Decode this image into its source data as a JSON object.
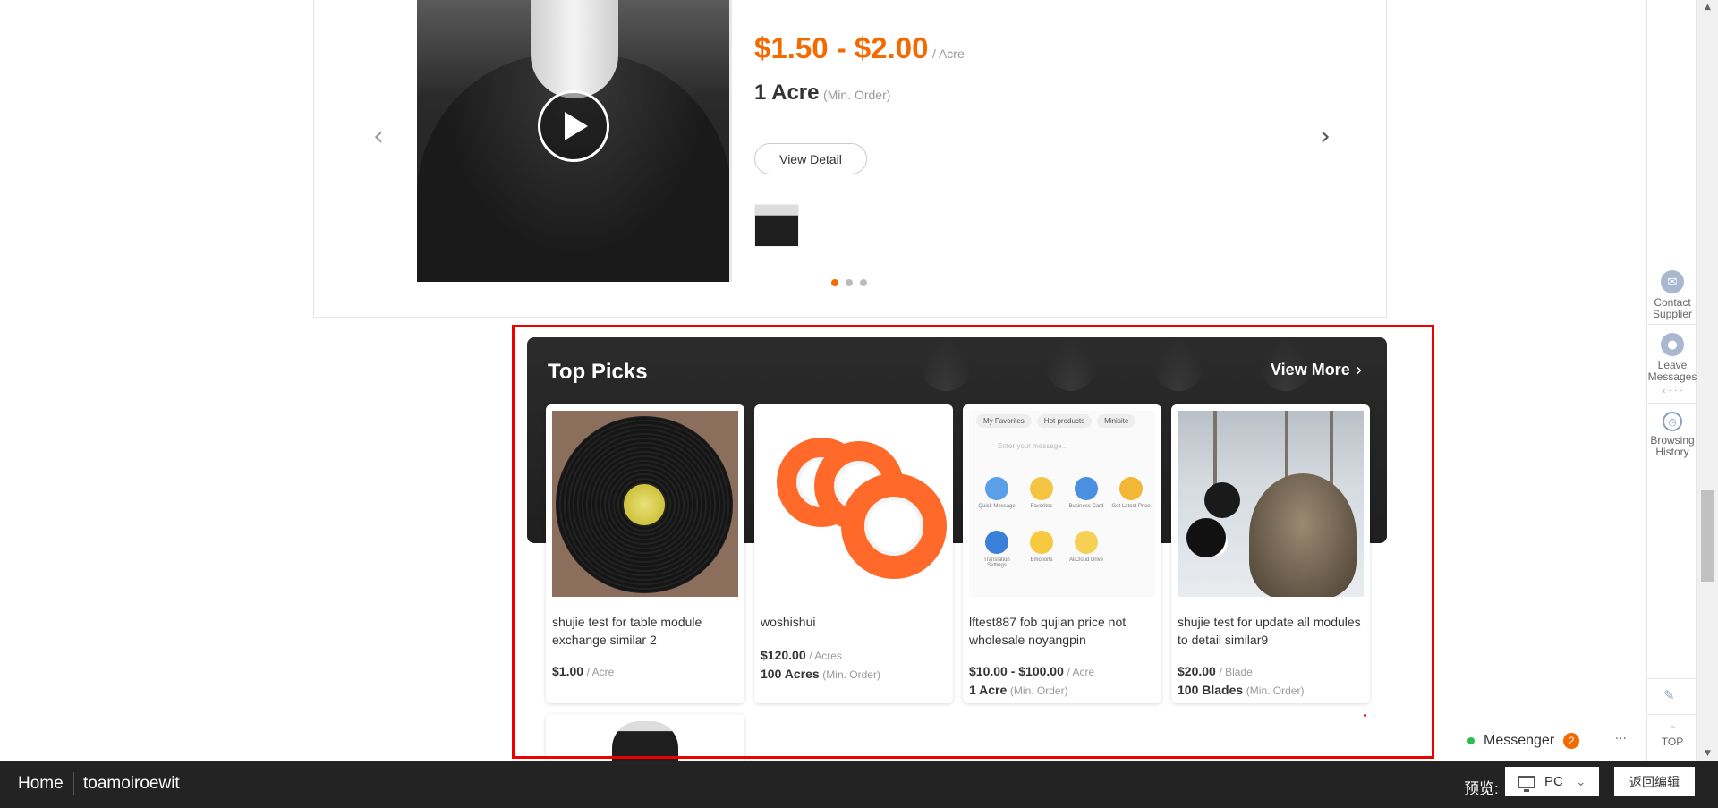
{
  "product": {
    "price": "$1.50 - $2.00",
    "price_unit": "/ Acre",
    "moq": "1 Acre",
    "moq_label": "(Min. Order)",
    "view_detail_label": "View Detail",
    "carousel_total": 3,
    "carousel_active": 1,
    "icons": {
      "prev": "chevron-left-icon",
      "next": "chevron-right-icon",
      "play": "play-icon"
    }
  },
  "top_picks": {
    "title": "Top Picks",
    "view_more_label": "View More",
    "view_more_icon": "chevron-right-icon",
    "items": [
      {
        "name": "shujie test for table module exchange similar 2",
        "price": "$1.00",
        "price_unit": "/ Acre",
        "moq": "",
        "moq_label": ""
      },
      {
        "name": "woshishui",
        "price": "$120.00",
        "price_unit": "/ Acres",
        "moq": "100 Acres",
        "moq_label": "(Min. Order)"
      },
      {
        "name": "lftest887 fob qujian price not wholesale noyangpin",
        "price": "$10.00 - $100.00",
        "price_unit": "/ Acre",
        "moq": "1 Acre",
        "moq_label": "(Min. Order)"
      },
      {
        "name": "shujie test for update all modules to detail similar9",
        "price": "$20.00",
        "price_unit": "/ Blade",
        "moq": "100 Blades",
        "moq_label": "(Min. Order)"
      }
    ],
    "app_screenshot": {
      "tabs": [
        "My Favorites",
        "Hot products",
        "Minisite"
      ],
      "search_placeholder": "Enter your message...",
      "icons": [
        "Quick Message",
        "Favorites",
        "Business Card",
        "Get Latest Price",
        "Translation Settings",
        "Emotions",
        "AliCloud Drive"
      ]
    }
  },
  "sidebar": {
    "items": [
      {
        "label": "Contact Supplier",
        "icon": "mail-icon"
      },
      {
        "label": "Leave Messages",
        "icon": "user-icon"
      },
      {
        "label": "Browsing History",
        "icon": "clock-icon"
      }
    ],
    "note_icon": "note-edit-icon",
    "top_label": "TOP"
  },
  "messenger": {
    "label": "Messenger",
    "count": "2",
    "more": "···"
  },
  "bottom_bar": {
    "home": "Home",
    "site": "toamoiroewit",
    "preview_label": "预览:",
    "device": "PC",
    "back_label": "返回编辑"
  },
  "colors": {
    "accent": "#f56a00",
    "frame": "#ee0000",
    "dark_band": "#232323",
    "bottom_bar": "#232323"
  }
}
